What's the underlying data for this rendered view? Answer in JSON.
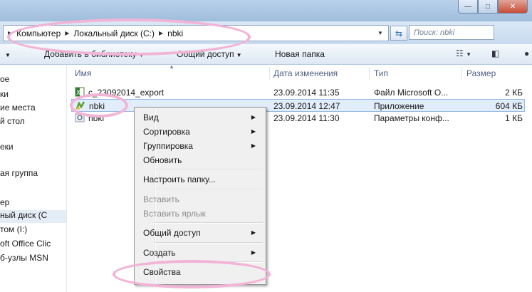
{
  "window": {
    "controls": {
      "minimize": "—",
      "maximize": "□",
      "close": "✕"
    }
  },
  "address": {
    "breadcrumbs": [
      "Компьютер",
      "Локальный диск (C:)",
      "nbki"
    ],
    "search_placeholder": "Поиск: nbki"
  },
  "toolbar": {
    "add_library": "Добавить в библиотеку",
    "share": "Общий доступ",
    "new_folder": "Новая папка"
  },
  "nav": {
    "items": [
      "ое",
      "ки",
      "ие места",
      "й стол",
      "еки",
      "ая группа",
      "ер",
      "ный диск (С",
      "том (I:)",
      "oft Office Clic",
      "б-узлы MSN"
    ]
  },
  "columns": {
    "name": "Имя",
    "date": "Дата изменения",
    "type": "Тип",
    "size": "Размер"
  },
  "files": [
    {
      "name": "c_23092014_export",
      "date": "23.09.2014 11:35",
      "type": "Файл Microsoft O...",
      "size": "2 КБ",
      "icon": "excel-file-icon"
    },
    {
      "name": "nbki",
      "date": "23.09.2014 12:47",
      "type": "Приложение",
      "size": "604 КБ",
      "icon": "application-icon"
    },
    {
      "name": "nbki",
      "date": "23.09.2014 11:30",
      "type": "Параметры конф...",
      "size": "1 КБ",
      "icon": "config-file-icon"
    }
  ],
  "context_menu": {
    "view": "Вид",
    "sort": "Сортировка",
    "group": "Группировка",
    "refresh": "Обновить",
    "customize": "Настроить папку...",
    "paste": "Вставить",
    "paste_shortcut": "Вставить ярлык",
    "share": "Общий доступ",
    "create": "Создать",
    "properties": "Свойства"
  },
  "colors": {
    "annotation": "#f2b4d6",
    "selection": "#e1edfb",
    "chrome": "#c8daef"
  }
}
